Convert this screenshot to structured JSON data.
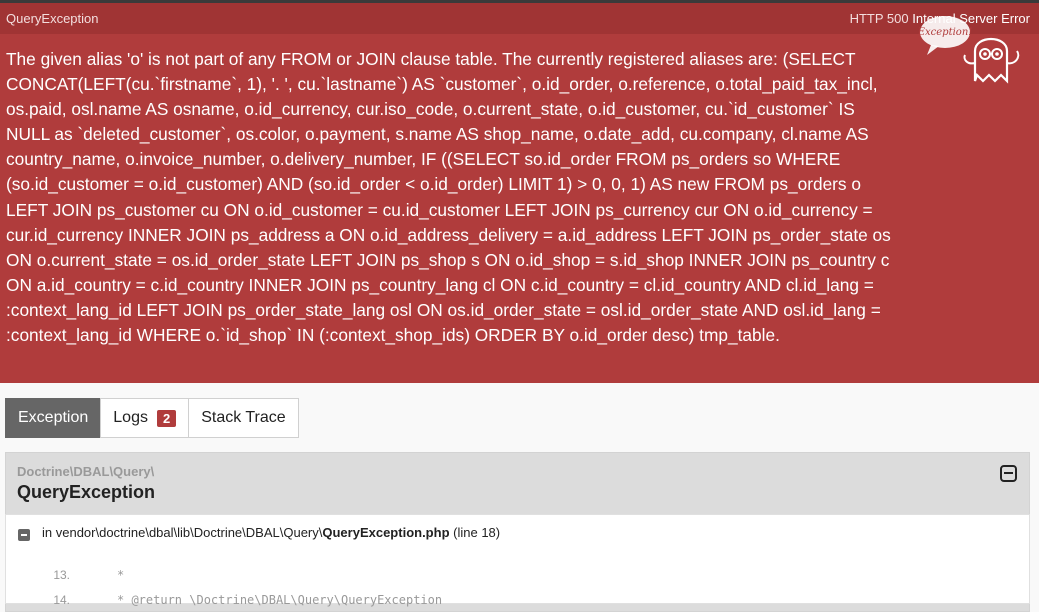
{
  "header": {
    "exception_class": "QueryException",
    "status_code": "HTTP 500",
    "status_text": "Internal Server Error"
  },
  "message": "The given alias 'o' is not part of any FROM or JOIN clause table. The currently registered aliases are: (SELECT CONCAT(LEFT(cu.`firstname`, 1), '. ', cu.`lastname`) AS `customer`, o.id_order, o.reference, o.total_paid_tax_incl, os.paid, osl.name AS osname, o.id_currency, cur.iso_code, o.current_state, o.id_customer, cu.`id_customer` IS NULL as `deleted_customer`, os.color, o.payment, s.name AS shop_name, o.date_add, cu.company, cl.name AS country_name, o.invoice_number, o.delivery_number, IF ((SELECT so.id_order FROM ps_orders so WHERE (so.id_customer = o.id_customer) AND (so.id_order < o.id_order) LIMIT 1) > 0, 0, 1) AS new FROM ps_orders o LEFT JOIN ps_customer cu ON o.id_customer = cu.id_customer LEFT JOIN ps_currency cur ON o.id_currency = cur.id_currency INNER JOIN ps_address a ON o.id_address_delivery = a.id_address LEFT JOIN ps_order_state os ON o.current_state = os.id_order_state LEFT JOIN ps_shop s ON o.id_shop = s.id_shop INNER JOIN ps_country c ON a.id_country = c.id_country INNER JOIN ps_country_lang cl ON c.id_country = cl.id_country AND cl.id_lang = :context_lang_id LEFT JOIN ps_order_state_lang osl ON os.id_order_state = osl.id_order_state AND osl.id_lang = :context_lang_id WHERE o.`id_shop` IN (:context_shop_ids) ORDER BY o.id_order desc) tmp_table.",
  "ghost_label": "Exception!",
  "tabs": [
    {
      "label": "Exception"
    },
    {
      "label": "Logs",
      "badge": "2"
    },
    {
      "label": "Stack Trace"
    }
  ],
  "exception": {
    "namespace": "Doctrine\\DBAL\\Query\\",
    "class": "QueryException"
  },
  "trace": {
    "prefix": "in vendor\\doctrine\\dbal\\lib\\Doctrine\\DBAL\\Query\\",
    "file": "QueryException.php",
    "line": "(line 18)",
    "code": [
      {
        "no": "13.",
        "src": "*"
      },
      {
        "no": "14.",
        "src": "* @return \\Doctrine\\DBAL\\Query\\QueryException"
      }
    ]
  },
  "colors": {
    "header": "#a03434",
    "panel": "#b03c3c",
    "active_tab": "#666666"
  }
}
